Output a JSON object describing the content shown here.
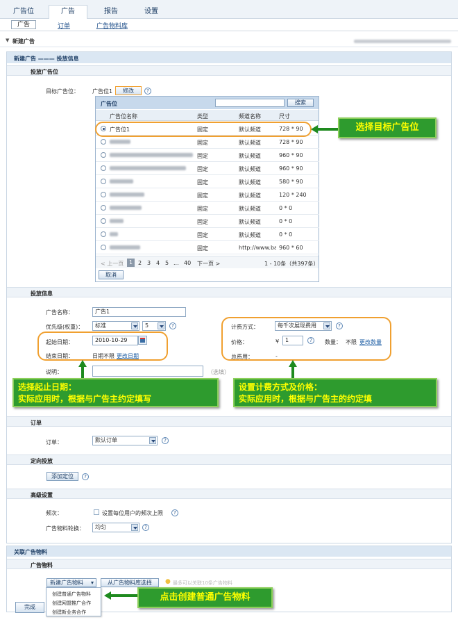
{
  "nav": {
    "tabs": [
      "广告位",
      "广告",
      "报告",
      "设置"
    ],
    "active_tab": "广告",
    "subtabs": [
      "广告",
      "订单",
      "广告物料库"
    ]
  },
  "panel": {
    "title": "新建广告"
  },
  "section_bar": "新建广告 ——— 投放信息",
  "placement": {
    "heading": "投放广告位",
    "target_label": "目标广告位：",
    "target_value": "广告位1",
    "edit_btn": "修改",
    "list_title": "广告位",
    "search_btn": "搜索",
    "columns": [
      "广告位名称",
      "类型",
      "频道名称",
      "尺寸"
    ],
    "rows": [
      {
        "name": "广告位1",
        "type": "固定",
        "channel": "默认频道",
        "size": "728 * 90",
        "selected": true
      },
      {
        "name": "",
        "type": "固定",
        "channel": "默认频道",
        "size": "728 * 90"
      },
      {
        "name": "",
        "type": "固定",
        "channel": "默认频道",
        "size": "960 * 90"
      },
      {
        "name": "",
        "type": "固定",
        "channel": "默认频道",
        "size": "960 * 90"
      },
      {
        "name": "",
        "type": "固定",
        "channel": "默认频道",
        "size": "580 * 90"
      },
      {
        "name": "",
        "type": "固定",
        "channel": "默认频道",
        "size": "120 * 240"
      },
      {
        "name": "",
        "type": "固定",
        "channel": "默认频道",
        "size": "0 * 0"
      },
      {
        "name": "",
        "type": "固定",
        "channel": "默认频道",
        "size": "0 * 0"
      },
      {
        "name": "",
        "type": "固定",
        "channel": "默认频道",
        "size": "0 * 0"
      },
      {
        "name": "",
        "type": "固定",
        "channel": "http://www.baidu",
        "size": "960 * 60"
      }
    ],
    "pager": {
      "prev": "< 上一页",
      "pages": [
        "1",
        "2",
        "3",
        "4",
        "5",
        "...",
        "40"
      ],
      "current": "1",
      "next": "下一页 >",
      "summary": "1 - 10条（共397条）"
    },
    "cancel_btn": "取消"
  },
  "delivery": {
    "heading": "投放信息",
    "name_label": "广告名称：",
    "name_value": "广告1",
    "priority_label": "优先级(权重)：",
    "priority_value": "标准",
    "weight_value": "5",
    "start_label": "起始日期：",
    "start_value": "2010-10-29",
    "end_label": "结束日期：",
    "end_value": "日期不限",
    "end_link": "更改日期",
    "desc_label": "说明：",
    "desc_hint": "（选填）",
    "billing_label": "计费方式：",
    "billing_value": "每千次展现费用",
    "price_label": "价格：",
    "currency": "¥",
    "price_value": "1",
    "qty_label": "数量：",
    "qty_value": "不限",
    "qty_link": "更改数量",
    "total_label": "总费用：",
    "total_value": "-"
  },
  "order": {
    "heading": "订单",
    "label": "订单：",
    "value": "默认订单"
  },
  "targeting": {
    "heading": "定向投放",
    "add_btn": "添加定位"
  },
  "advanced": {
    "heading": "高级设置",
    "freq_label": "频次：",
    "freq_checkbox": "设置每位用户的频次上限",
    "rotation_label": "广告物料轮换：",
    "rotation_value": "均匀"
  },
  "material": {
    "section_bar": "关联广告物料",
    "heading": "广告物料",
    "new_btn": "新建广告物料",
    "lib_btn": "从广告物料库选择",
    "tip": "最多可以关联10条广告物料",
    "menu": [
      "创建普通广告物料",
      "创建网盟推广合作",
      "创建新业务合作"
    ]
  },
  "finish_btn": "完成",
  "callouts": {
    "target": "选择目标广告位",
    "dates": "选择起止日期：\n实际应用时，根据与广告主约定填写",
    "billing": "设置计费方式及价格：\n实际应用时，根据与广告主的约定填",
    "material": "点击创建普通广告物料"
  },
  "colors": {
    "callout_bg": "#2e9b2e",
    "callout_text": "#ffff00",
    "highlight": "#f0a030",
    "accent": "#1f3f66"
  }
}
